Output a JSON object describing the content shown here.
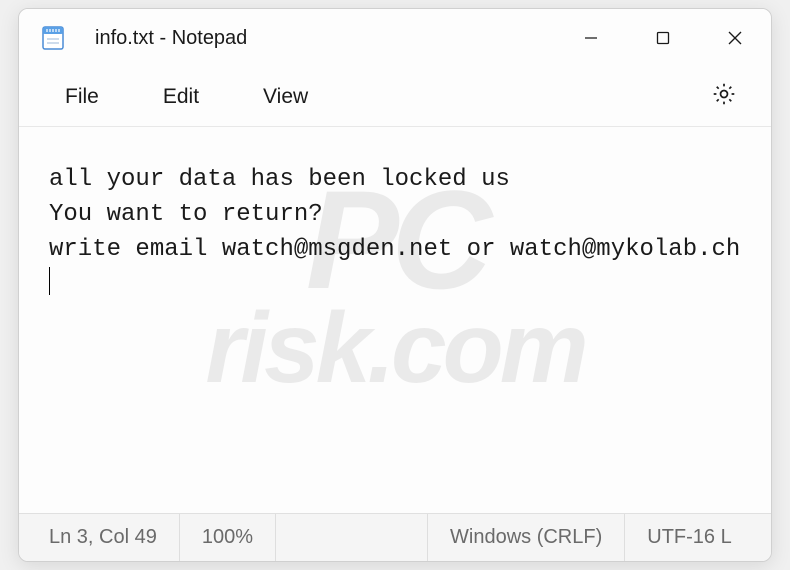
{
  "titlebar": {
    "title": "info.txt - Notepad"
  },
  "menubar": {
    "file": "File",
    "edit": "Edit",
    "view": "View"
  },
  "editor": {
    "content": "all your data has been locked us\nYou want to return?\nwrite email watch@msgden.net or watch@mykolab.ch"
  },
  "statusbar": {
    "position": "Ln 3, Col 49",
    "zoom": "100%",
    "lineending": "Windows (CRLF)",
    "encoding": "UTF-16 L"
  },
  "watermark": {
    "top": "PC",
    "bottom": "risk.com"
  }
}
